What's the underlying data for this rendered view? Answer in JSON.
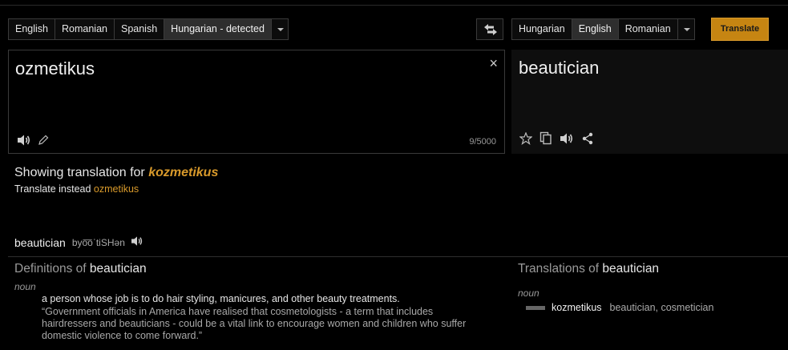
{
  "source_langs": {
    "items": [
      "English",
      "Romanian",
      "Spanish",
      "Hungarian - detected"
    ],
    "selected_index": 3
  },
  "target_langs": {
    "items": [
      "Hungarian",
      "English",
      "Romanian"
    ],
    "selected_index": 1
  },
  "translate_button": "Translate",
  "source": {
    "text": "ozmetikus",
    "clear_glyph": "×",
    "char_count": "9/5000"
  },
  "target": {
    "text": "beautician"
  },
  "correction": {
    "showing_prefix": "Showing translation for ",
    "corrected": "kozmetikus",
    "instead_prefix": "Translate instead ",
    "original": "ozmetikus"
  },
  "word": {
    "term": "beautician",
    "phonetic": "byo͞oˈtiSHən"
  },
  "definitions": {
    "heading_prefix": "Definitions of ",
    "heading_word": "beautician",
    "pos": "noun",
    "definition": "a person whose job is to do hair styling, manicures, and other beauty treatments.",
    "example": "“Government officials in America have realised that cosmetologists - a term that includes hairdressers and beauticians - could be a vital link to encourage women and children who suffer domestic violence to come forward.”"
  },
  "translations": {
    "heading_prefix": "Translations of ",
    "heading_word": "beautician",
    "pos": "noun",
    "word": "kozmetikus",
    "synonyms": "beautician, cosmetician"
  },
  "colors": {
    "accent": "#d99a2b",
    "button": "#c68512",
    "background": "#000000"
  },
  "icons": [
    "swap-icon",
    "close-icon",
    "speaker-icon",
    "pencil-icon",
    "star-icon",
    "copy-icon",
    "share-icon",
    "chevron-down-icon"
  ]
}
